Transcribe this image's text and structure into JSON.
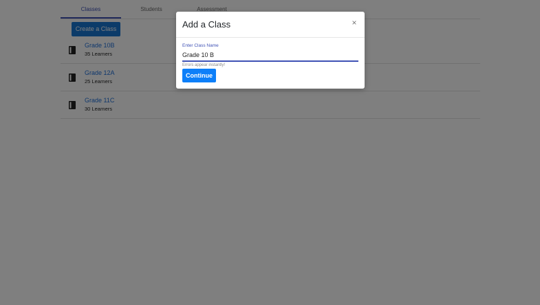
{
  "tabs": [
    {
      "label": "Classes",
      "active": true
    },
    {
      "label": "Students",
      "active": false
    },
    {
      "label": "Assessment",
      "active": false
    }
  ],
  "create_button_label": "Create a Class",
  "classes": [
    {
      "name": "Grade 10B",
      "learners": "35 Learners",
      "icon": "book-icon"
    },
    {
      "name": "Grade 12A",
      "learners": "25 Learners",
      "icon": "book-icon"
    },
    {
      "name": "Grade 11C",
      "learners": "30 Learners",
      "icon": "book-icon"
    }
  ],
  "modal": {
    "title": "Add a Class",
    "close_symbol": "×",
    "field_label": "Enter Class Name",
    "field_value": "Grade 10 B",
    "helper_text": "Errors appear instantly!",
    "continue_label": "Continue"
  },
  "colors": {
    "primary": "#1976d2",
    "accent": "#3f51b5",
    "link": "#1e6fd9",
    "continue": "#0d7ff9",
    "overlay": "rgba(0,0,0,0.5)"
  }
}
